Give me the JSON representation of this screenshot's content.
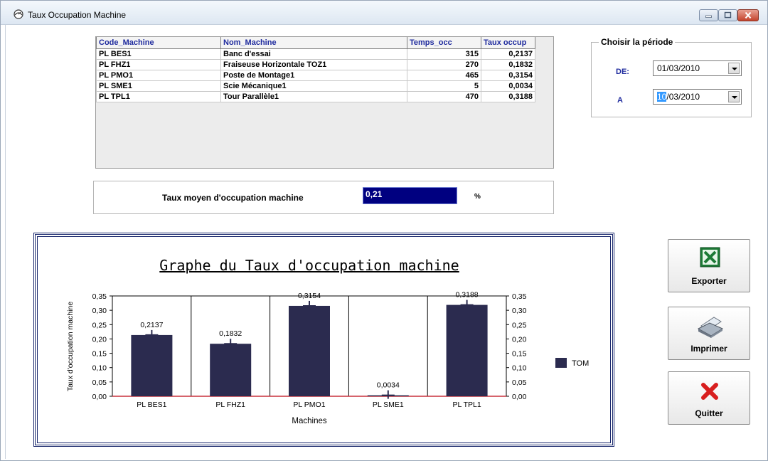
{
  "window": {
    "title": "Taux Occupation Machine"
  },
  "grid": {
    "columns": [
      "Code_Machine",
      "Nom_Machine",
      "Temps_occ",
      "Taux occup"
    ],
    "rows": [
      [
        "PL BES1",
        "Banc d'essai",
        "315",
        "0,2137"
      ],
      [
        "PL FHZ1",
        "Fraiseuse Horizontale TOZ1",
        "270",
        "0,1832"
      ],
      [
        "PL PMO1",
        "Poste de Montage1",
        "465",
        "0,3154"
      ],
      [
        "PL SME1",
        "Scie Mécanique1",
        "5",
        "0,0034"
      ],
      [
        "PL TPL1",
        "Tour Parallèle1",
        "470",
        "0,3188"
      ]
    ]
  },
  "average": {
    "label": "Taux moyen d'occupation machine",
    "value": "0,21",
    "unit": "%"
  },
  "period": {
    "title": "Choisir la période",
    "from_label": "DE:",
    "from_value": "01/03/2010",
    "to_label": "A",
    "to_value_selected": "10",
    "to_value_rest": "/03/2010"
  },
  "buttons": {
    "export": "Exporter",
    "print": "Imprimer",
    "quit": "Quitter"
  },
  "chart_data": {
    "type": "bar",
    "title": "Graphe du Taux d'occupation machine",
    "xlabel": "Machines",
    "ylabel": "Taux d'occupation machine",
    "categories": [
      "PL BES1",
      "PL FHZ1",
      "PL PMO1",
      "PL SME1",
      "PL TPL1"
    ],
    "series": [
      {
        "name": "TOM",
        "values": [
          0.2137,
          0.1832,
          0.3154,
          0.0034,
          0.3188
        ]
      }
    ],
    "value_labels": [
      "0,2137",
      "0,1832",
      "0,3154",
      "0,0034",
      "0,3188"
    ],
    "ylim": [
      0,
      0.35
    ],
    "yticks": [
      "0,00",
      "0,05",
      "0,10",
      "0,15",
      "0,20",
      "0,25",
      "0,30",
      "0,35"
    ],
    "grid": true,
    "legend": "right",
    "colors": {
      "bar": "#2b2b4f",
      "baseline": "#c8303c",
      "frame": "#1c2a6e"
    }
  }
}
